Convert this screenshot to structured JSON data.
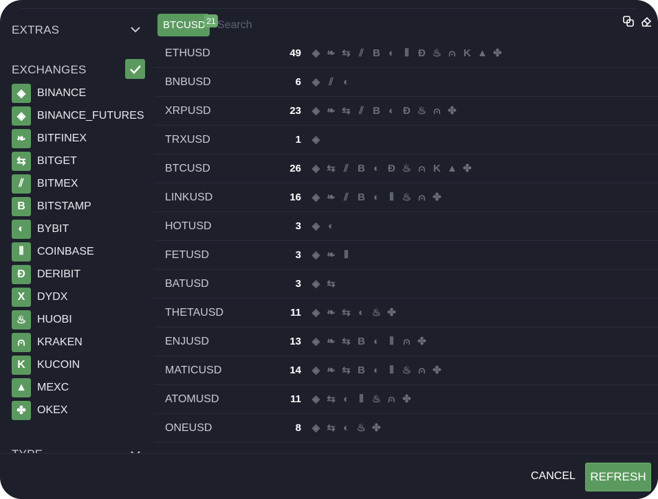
{
  "sidebar": {
    "extras_label": "EXTRAS",
    "exchanges_label": "EXCHANGES",
    "type_label": "TYPE",
    "exchanges": [
      {
        "key": "binance",
        "label": "BINANCE",
        "glyph": "◈"
      },
      {
        "key": "binance_futures",
        "label": "BINANCE_FUTURES",
        "glyph": "◈"
      },
      {
        "key": "bitfinex",
        "label": "BITFINEX",
        "glyph": "❧"
      },
      {
        "key": "bitget",
        "label": "BITGET",
        "glyph": "⇆"
      },
      {
        "key": "bitmex",
        "label": "BITMEX",
        "glyph": "⫽"
      },
      {
        "key": "bitstamp",
        "label": "BITSTAMP",
        "glyph": "B"
      },
      {
        "key": "bybit",
        "label": "BYBIT",
        "glyph": "◐"
      },
      {
        "key": "coinbase",
        "label": "COINBASE",
        "glyph": "⦀"
      },
      {
        "key": "deribit",
        "label": "DERIBIT",
        "glyph": "Đ"
      },
      {
        "key": "dydx",
        "label": "DYDX",
        "glyph": "X"
      },
      {
        "key": "huobi",
        "label": "HUOBI",
        "glyph": "♨"
      },
      {
        "key": "kraken",
        "label": "KRAKEN",
        "glyph": "⩀"
      },
      {
        "key": "kucoin",
        "label": "KUCOIN",
        "glyph": "K"
      },
      {
        "key": "mexc",
        "label": "MEXC",
        "glyph": "▲"
      },
      {
        "key": "okex",
        "label": "OKEX",
        "glyph": "✤"
      }
    ]
  },
  "search": {
    "chip_label": "BTCUSD",
    "chip_count": "21",
    "placeholder": "Search"
  },
  "toolbar": {
    "copy_icon": "copy-icon",
    "clear_icon": "eraser-icon"
  },
  "rows": [
    {
      "symbol": "ETHUSD",
      "count": "49",
      "exchanges": [
        "binance",
        "bitfinex",
        "bitget",
        "bitmex",
        "bitstamp",
        "bybit",
        "coinbase",
        "deribit",
        "huobi",
        "kraken",
        "kucoin",
        "mexc",
        "okex"
      ]
    },
    {
      "symbol": "BNBUSD",
      "count": "6",
      "exchanges": [
        "binance",
        "bitmex",
        "bybit"
      ]
    },
    {
      "symbol": "XRPUSD",
      "count": "23",
      "exchanges": [
        "binance",
        "bitfinex",
        "bitget",
        "bitmex",
        "bitstamp",
        "bybit",
        "deribit",
        "huobi",
        "kraken",
        "okex"
      ]
    },
    {
      "symbol": "TRXUSD",
      "count": "1",
      "exchanges": [
        "binance"
      ]
    },
    {
      "symbol": "BTCUSD",
      "count": "26",
      "exchanges": [
        "binance",
        "bitget",
        "bitmex",
        "bitstamp",
        "bybit",
        "deribit",
        "huobi",
        "kraken",
        "kucoin",
        "mexc",
        "okex"
      ]
    },
    {
      "symbol": "LINKUSD",
      "count": "16",
      "exchanges": [
        "binance",
        "bitfinex",
        "bitmex",
        "bitstamp",
        "bybit",
        "coinbase",
        "huobi",
        "kraken",
        "okex"
      ]
    },
    {
      "symbol": "HOTUSD",
      "count": "3",
      "exchanges": [
        "binance",
        "bybit"
      ]
    },
    {
      "symbol": "FETUSD",
      "count": "3",
      "exchanges": [
        "binance",
        "bitfinex",
        "coinbase"
      ]
    },
    {
      "symbol": "BATUSD",
      "count": "3",
      "exchanges": [
        "binance",
        "bitget"
      ]
    },
    {
      "symbol": "THETAUSD",
      "count": "11",
      "exchanges": [
        "binance",
        "bitfinex",
        "bitget",
        "bybit",
        "huobi",
        "okex"
      ]
    },
    {
      "symbol": "ENJUSD",
      "count": "13",
      "exchanges": [
        "binance",
        "bitfinex",
        "bitget",
        "bitstamp",
        "bybit",
        "coinbase",
        "kraken",
        "okex"
      ]
    },
    {
      "symbol": "MATICUSD",
      "count": "14",
      "exchanges": [
        "binance",
        "bitfinex",
        "bitget",
        "bitstamp",
        "bybit",
        "coinbase",
        "huobi",
        "kraken",
        "okex"
      ]
    },
    {
      "symbol": "ATOMUSD",
      "count": "11",
      "exchanges": [
        "binance",
        "bitget",
        "bybit",
        "coinbase",
        "huobi",
        "kraken",
        "okex"
      ]
    },
    {
      "symbol": "ONEUSD",
      "count": "8",
      "exchanges": [
        "binance",
        "bitget",
        "bybit",
        "huobi",
        "okex"
      ]
    }
  ],
  "footer": {
    "cancel_label": "CANCEL",
    "refresh_label": "REFRESH"
  },
  "colors": {
    "accent": "#5b9a5f",
    "background": "#1d202b",
    "icon_muted": "#6a6d78"
  }
}
